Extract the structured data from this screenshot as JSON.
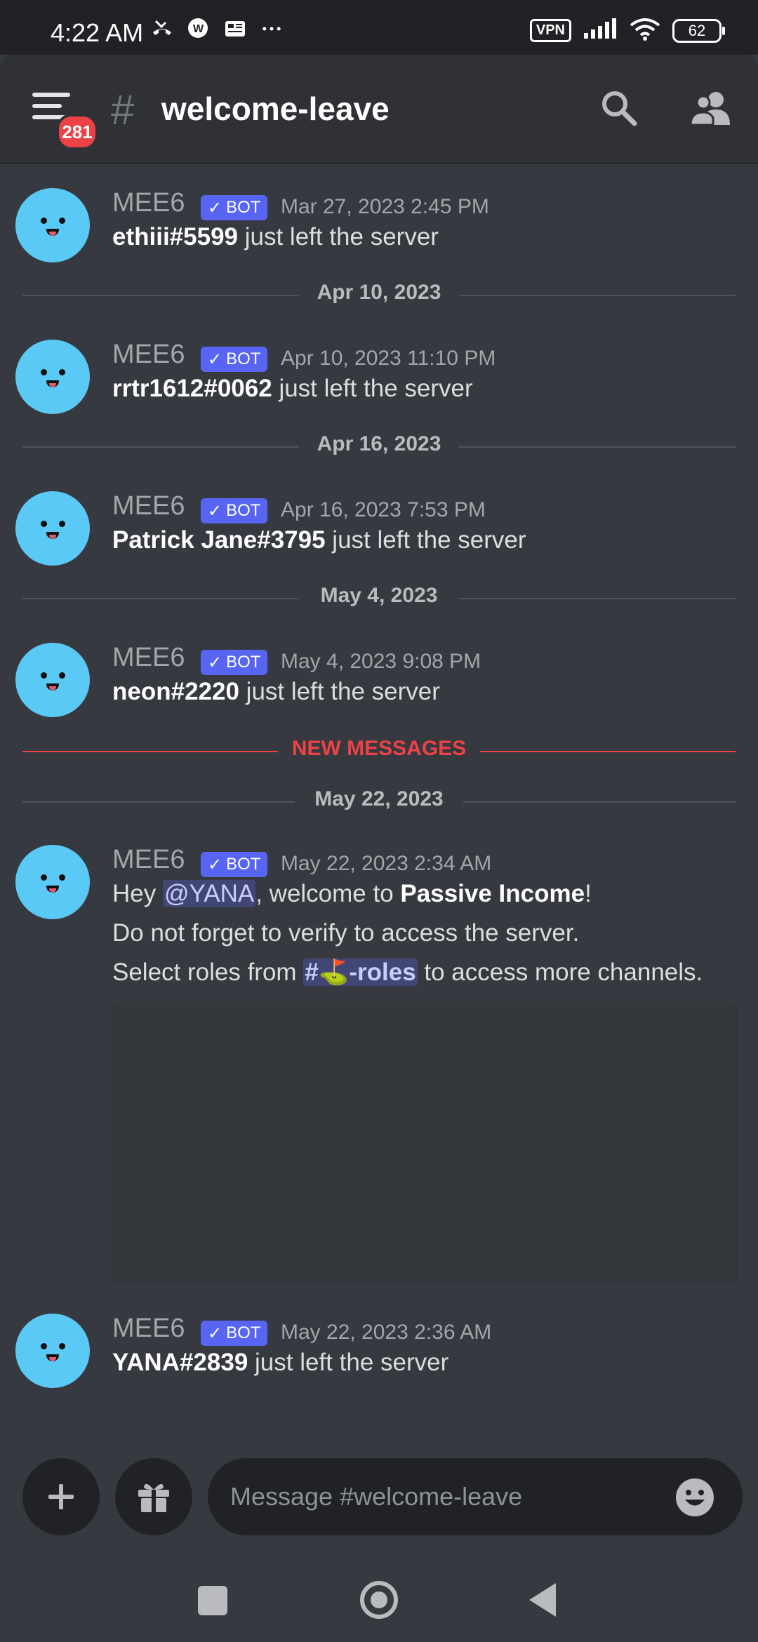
{
  "status_bar": {
    "time": "4:22 AM",
    "left_icons": [
      "missed-call-icon",
      "whatsapp-business-icon",
      "news-icon",
      "more-dots-icon"
    ],
    "vpn": "VPN",
    "battery": "62"
  },
  "header": {
    "hash": "#",
    "channel_name": "welcome-leave",
    "menu_badge": "281"
  },
  "messages": [
    {
      "author": "MEE6",
      "bot_tag": "BOT",
      "timestamp": "Mar 27, 2023 2:45 PM",
      "user": "ethiii#5599",
      "text": " just left the server"
    },
    {
      "author": "MEE6",
      "bot_tag": "BOT",
      "timestamp": "Apr 10, 2023 11:10 PM",
      "user": "rrtr1612#0062",
      "text": " just left the server"
    },
    {
      "author": "MEE6",
      "bot_tag": "BOT",
      "timestamp": "Apr 16, 2023 7:53 PM",
      "user": "Patrick Jane#3795",
      "text": " just left the server"
    },
    {
      "author": "MEE6",
      "bot_tag": "BOT",
      "timestamp": "May 4, 2023 9:08 PM",
      "user": "neon#2220",
      "text": " just left the server"
    },
    {
      "author": "MEE6",
      "bot_tag": "BOT",
      "timestamp": "May 22, 2023 2:34 AM",
      "line1_prefix": "Hey ",
      "mention": "@YANA",
      "line1_mid": ", welcome to ",
      "server": "Passive Income",
      "line1_end": "!",
      "line2": "Do not forget to verify to access the server.",
      "line3_prefix": "Select roles from ",
      "channel_mention": "#⛳-roles",
      "line3_end": " to access more channels."
    },
    {
      "author": "MEE6",
      "bot_tag": "BOT",
      "timestamp": "May 22, 2023 2:36 AM",
      "user": "YANA#2839",
      "text": " just left the server"
    }
  ],
  "dividers": {
    "d1": "Apr 10, 2023",
    "d2": "Apr 16, 2023",
    "d3": "May 4, 2023",
    "new": "NEW MESSAGES",
    "d4": "May 22, 2023"
  },
  "composer": {
    "placeholder": "Message #welcome-leave"
  },
  "colors": {
    "background": "#36393f",
    "header": "#2f3136",
    "blurple": "#5865f2",
    "danger": "#ed4245",
    "avatar": "#5bc9f5"
  }
}
